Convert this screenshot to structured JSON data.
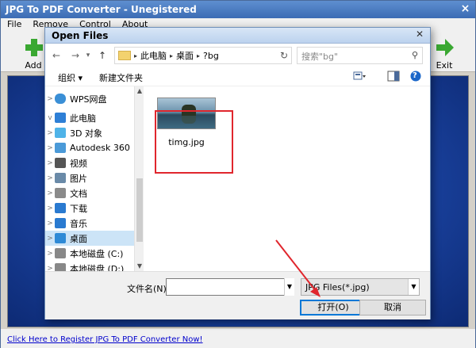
{
  "app": {
    "title": "JPG To PDF Converter - Unegistered",
    "close_glyph": "×",
    "menu": [
      "File",
      "Remove",
      "Control",
      "About"
    ],
    "toolbar": {
      "add_label": "Add",
      "exit_label": "Exit"
    },
    "register_link": "Click Here to Register JPG To PDF Converter Now!"
  },
  "dialog": {
    "title": "Open Files",
    "close_glyph": "✕",
    "nav": {
      "back": "←",
      "forward": "→",
      "dropdown": "▾",
      "up": "↑",
      "refresh": "↻"
    },
    "breadcrumb": [
      "此电脑",
      "桌面",
      "?bg"
    ],
    "search_placeholder": "搜索\"bg\"",
    "search_icon": "⚲",
    "commands": {
      "organize": "组织 ▾",
      "new_folder": "新建文件夹",
      "help_icon": "?"
    },
    "tree": [
      {
        "label": "WPS网盘",
        "icon": "cloud-icon",
        "chev": ">",
        "selected": false
      },
      {
        "label": "此电脑",
        "icon": "computer-icon",
        "chev": "v",
        "selected": false
      },
      {
        "label": "3D 对象",
        "icon": "cube-icon",
        "chev": ">",
        "selected": false
      },
      {
        "label": "Autodesk 360",
        "icon": "autodesk-icon",
        "chev": ">",
        "selected": false
      },
      {
        "label": "视频",
        "icon": "video-icon",
        "chev": ">",
        "selected": false
      },
      {
        "label": "图片",
        "icon": "picture-icon",
        "chev": ">",
        "selected": false
      },
      {
        "label": "文档",
        "icon": "document-icon",
        "chev": ">",
        "selected": false
      },
      {
        "label": "下载",
        "icon": "download-icon",
        "chev": ">",
        "selected": false
      },
      {
        "label": "音乐",
        "icon": "music-icon",
        "chev": ">",
        "selected": false
      },
      {
        "label": "桌面",
        "icon": "desktop-icon",
        "chev": ">",
        "selected": true
      },
      {
        "label": "本地磁盘 (C:)",
        "icon": "drive-icon",
        "chev": ">",
        "selected": false
      },
      {
        "label": "本地磁盘 (D:)",
        "icon": "drive-icon",
        "chev": ">",
        "selected": false
      }
    ],
    "files": [
      {
        "name": "timg.jpg"
      }
    ],
    "filename_label": "文件名(N):",
    "filename_value": "",
    "filetype_value": "JPG Files(*.jpg)",
    "open_button": "打开(O)",
    "cancel_button": "取消"
  },
  "colors": {
    "highlight_box": "#e0262d",
    "annotation_arrow": "#e0262d",
    "canvas_blue": "#1c46a6"
  }
}
